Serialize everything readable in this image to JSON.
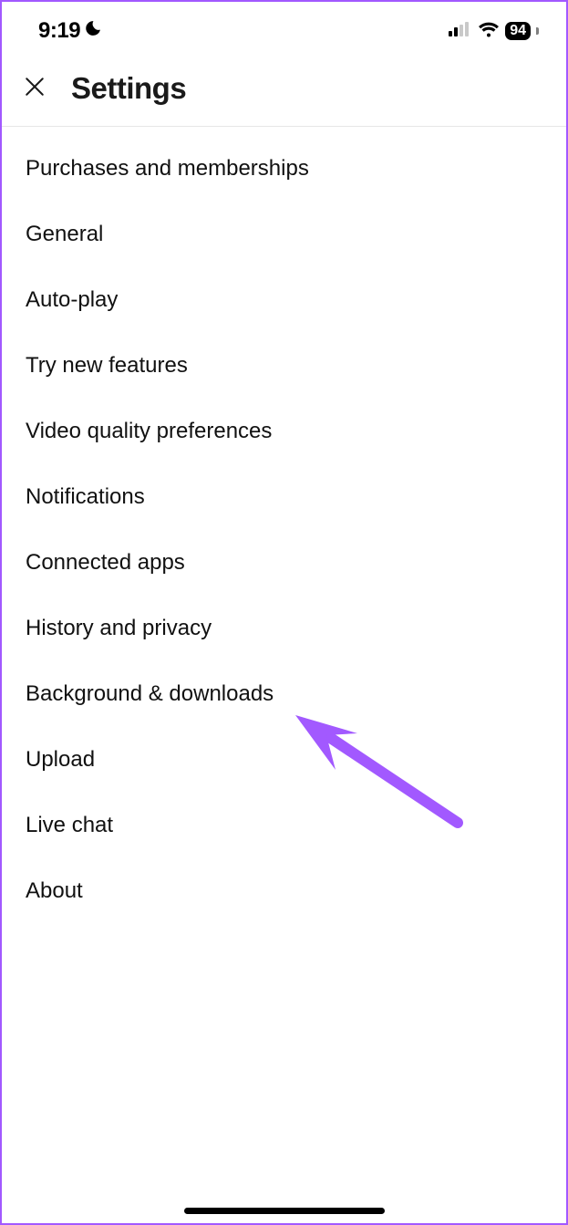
{
  "status": {
    "time": "9:19",
    "battery": "94"
  },
  "header": {
    "title": "Settings"
  },
  "menu": {
    "items": [
      {
        "label": "Purchases and memberships"
      },
      {
        "label": "General"
      },
      {
        "label": "Auto-play"
      },
      {
        "label": "Try new features"
      },
      {
        "label": "Video quality preferences"
      },
      {
        "label": "Notifications"
      },
      {
        "label": "Connected apps"
      },
      {
        "label": "History and privacy"
      },
      {
        "label": "Background & downloads"
      },
      {
        "label": "Upload"
      },
      {
        "label": "Live chat"
      },
      {
        "label": "About"
      }
    ]
  },
  "annotation": {
    "arrow_color": "#a259ff"
  }
}
